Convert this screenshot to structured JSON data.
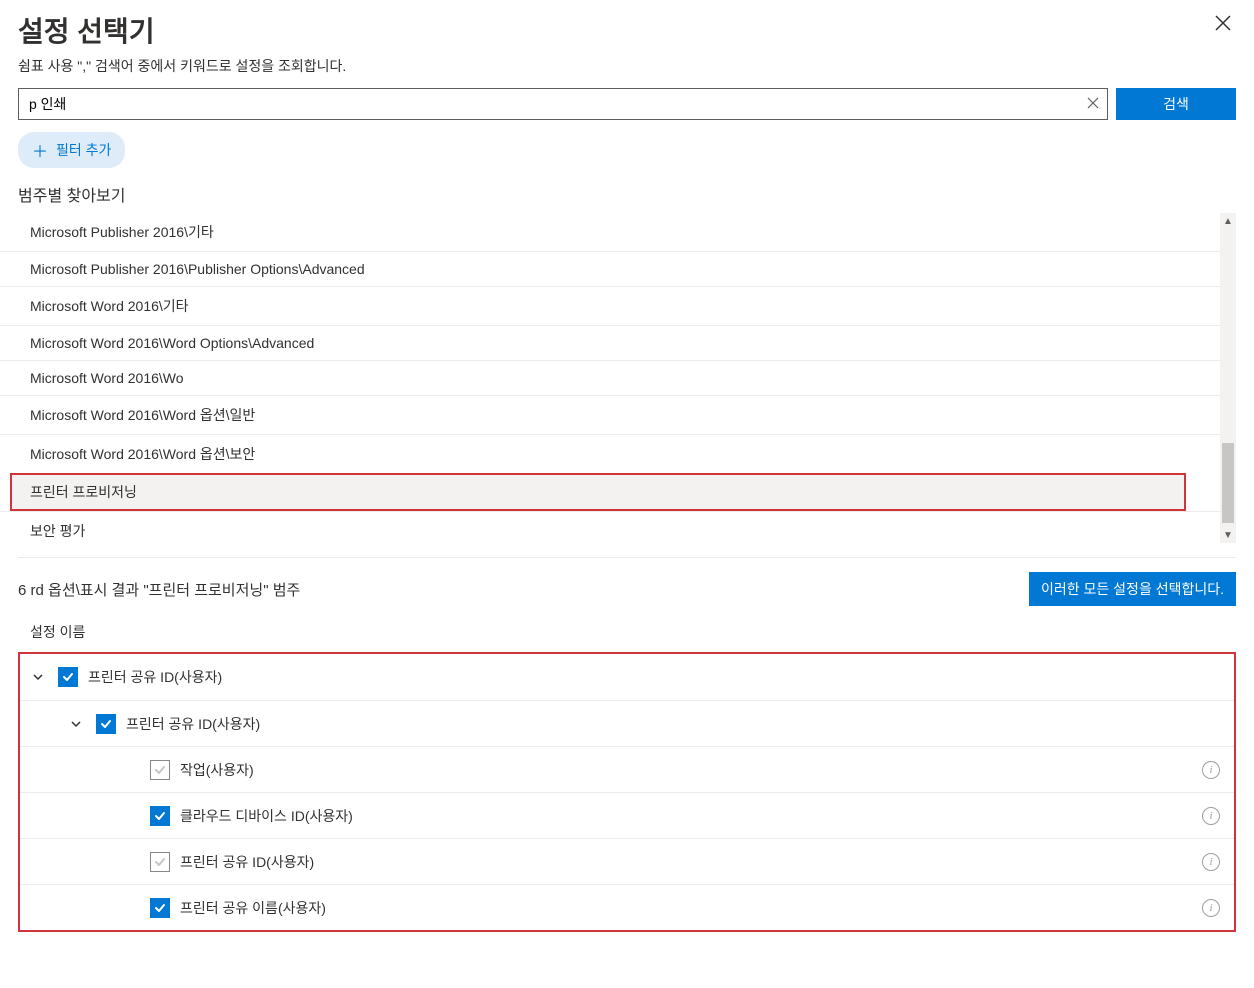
{
  "header": {
    "title": "설정 선택기",
    "subtitle": "쉼표 사용 \",\" 검색어 중에서 키워드로 설정을 조회합니다."
  },
  "search": {
    "value": "p 인쇄",
    "button": "검색"
  },
  "filter": {
    "add_label": "필터 추가"
  },
  "browse": {
    "heading": "범주별 찾아보기",
    "categories": [
      "Microsoft Publisher 2016\\기타",
      "Microsoft Publisher 2016\\Publisher Options\\Advanced",
      "Microsoft Word 2016\\기타",
      "Microsoft Word 2016\\Word Options\\Advanced",
      "Microsoft Word 2016\\Wo",
      "Microsoft Word 2016\\Word 옵션\\일반",
      "Microsoft Word 2016\\Word 옵션\\보안",
      "프린터 프로비저닝",
      "보안 평가"
    ],
    "selected_index": 7
  },
  "results": {
    "summary": "6 rd 옵션\\표시 결과 \"프린터 프로비저닝\" 범주",
    "select_all": "이러한 모든 설정을 선택합니다.",
    "column_label": "설정 이름",
    "tree": [
      {
        "level": 1,
        "expand": true,
        "checked": "checked",
        "label": "프린터 공유 ID(사용자)",
        "info": false
      },
      {
        "level": 2,
        "expand": true,
        "checked": "checked",
        "label": "프린터 공유 ID(사용자)",
        "info": false
      },
      {
        "level": 3,
        "expand": false,
        "checked": "partial",
        "label": "작업(사용자)",
        "info": true
      },
      {
        "level": 3,
        "expand": false,
        "checked": "checked",
        "label": "클라우드 디바이스 ID(사용자)",
        "info": true
      },
      {
        "level": 3,
        "expand": false,
        "checked": "partial",
        "label": "프린터 공유 ID(사용자)",
        "info": true
      },
      {
        "level": 3,
        "expand": false,
        "checked": "checked",
        "label": "프린터 공유 이름(사용자)",
        "info": true
      }
    ]
  }
}
